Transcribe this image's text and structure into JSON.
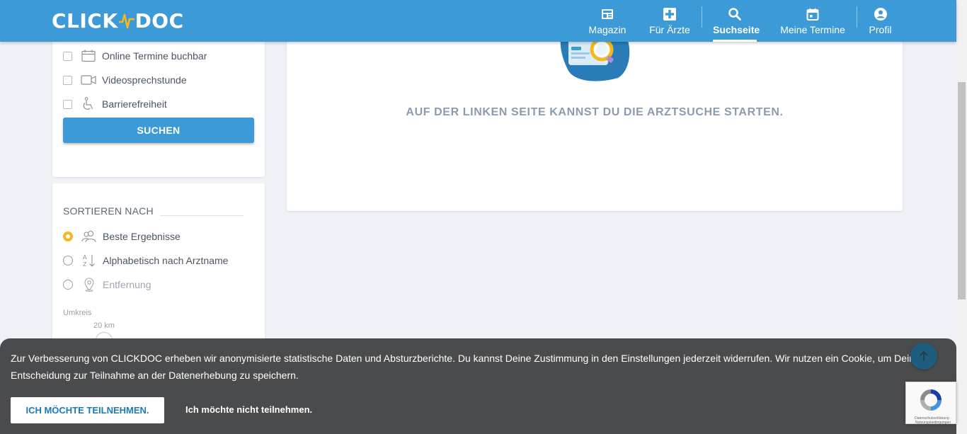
{
  "header": {
    "logo_left": "CLICK",
    "logo_right": "DOC",
    "nav": [
      {
        "label": "Magazin",
        "icon": "newspaper-icon"
      },
      {
        "label": "Für Ärzte",
        "icon": "medical-plus-icon"
      },
      {
        "label": "Suchseite",
        "icon": "search-icon",
        "active": true
      },
      {
        "label": "Meine Termine",
        "icon": "calendar-icon"
      },
      {
        "label": "Profil",
        "icon": "user-circle-icon"
      }
    ]
  },
  "filters": {
    "options": [
      {
        "label": "Online Termine buchbar",
        "icon": "calendar-outline-icon",
        "checked": false
      },
      {
        "label": "Videosprechstunde",
        "icon": "video-camera-icon",
        "checked": false
      },
      {
        "label": "Barrierefreiheit",
        "icon": "wheelchair-icon",
        "checked": false
      }
    ],
    "search_button": "SUCHEN"
  },
  "sort": {
    "title": "SORTIEREN NACH",
    "options": [
      {
        "label": "Beste Ergebnisse",
        "icon": "users-icon",
        "selected": true
      },
      {
        "label": "Alphabetisch nach Arztname",
        "icon": "sort-alpha-icon",
        "selected": false
      },
      {
        "label": "Entfernung",
        "icon": "location-pin-icon",
        "selected": false,
        "disabled": true
      }
    ],
    "radius_label": "Umkreis",
    "radius_value": "20 km",
    "radius_min": "1",
    "radius_max": "100"
  },
  "main": {
    "message": "AUF DER LINKEN SEITE KANNST DU DIE ARZTSUCHE STARTEN."
  },
  "cookie": {
    "text": "Zur Verbesserung von CLICKDOC erheben wir anonymisierte statistische Daten und Absturzberichte. Du kannst Deine Zustimmung in den Einstellungen jederzeit widerrufen. Wir nutzen ein Cookie, um Deine Entscheidung zur Teilnahme an der Datenerhebung zu speichern.",
    "accept": "ICH MÖCHTE TEILNEHMEN.",
    "decline": "Ich möchte nicht teilnehmen."
  },
  "recaptcha": {
    "text": "Datenschutzerklärung · Nutzungsbedingungen"
  },
  "colors": {
    "brand": "#3c9ad6",
    "accent": "#f3b820",
    "banner": "#4a4b4d"
  }
}
